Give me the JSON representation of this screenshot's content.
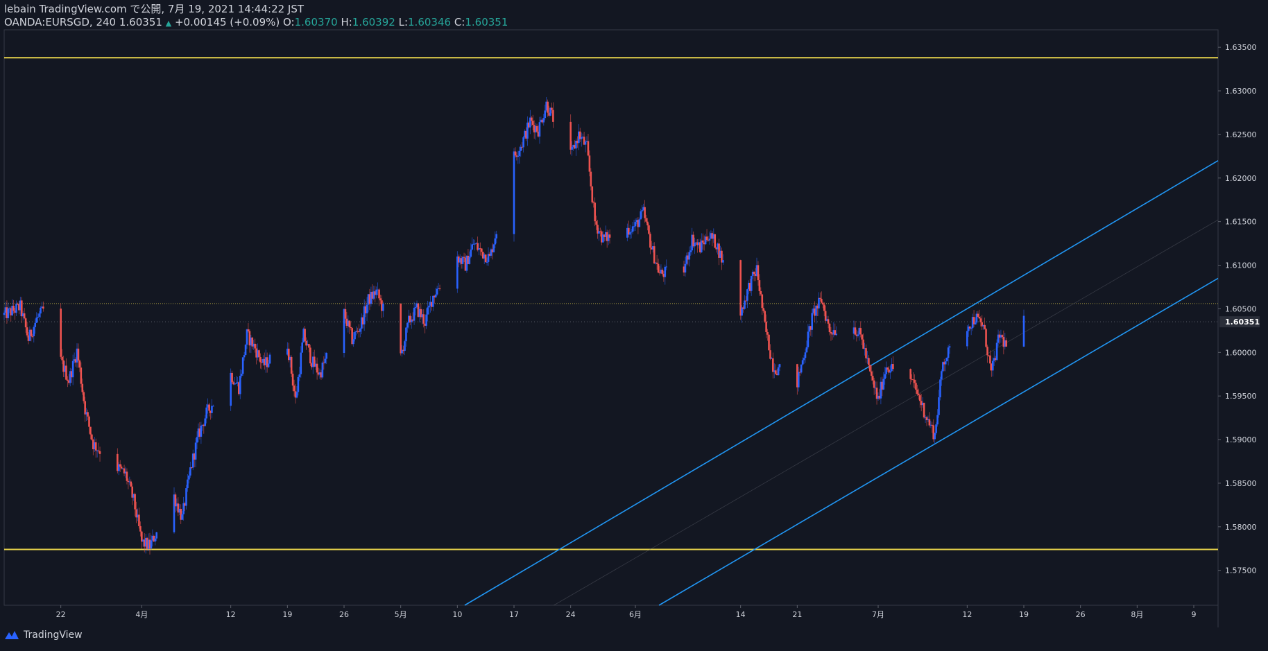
{
  "header": {
    "line1": "lebain TradingView.com で公開, 7月 19, 2021 14:44:22 JST",
    "symbol": "OANDA:EURSGD, 240 1.60351",
    "change_arrow": "▲",
    "change": "+0.00145 (+0.09%)",
    "o_label": "O:",
    "o_value": "1.60370",
    "h_label": "H:",
    "h_value": "1.60392",
    "l_label": "L:",
    "l_value": "1.60346",
    "c_label": "C:",
    "c_value": "1.60351"
  },
  "footer": {
    "brand": "TradingView"
  },
  "colors": {
    "background": "#131722",
    "up": "#2962ff",
    "down": "#ef5350",
    "levels": "#e6d24b",
    "channel": "#2196f3",
    "axis_text": "#d1d4dc"
  },
  "chart_data": {
    "type": "candlestick",
    "ylim": [
      1.571,
      1.637
    ],
    "y_ticks": [
      "1.57500",
      "1.58000",
      "1.58500",
      "1.59000",
      "1.59500",
      "1.60000",
      "1.60500",
      "1.61000",
      "1.61500",
      "1.62000",
      "1.62500",
      "1.63000",
      "1.63500"
    ],
    "x_ticks": [
      "22",
      "4月",
      "12",
      "19",
      "26",
      "5月",
      "10",
      "17",
      "24",
      "6月",
      "14",
      "21",
      "7月",
      "12",
      "19",
      "26",
      "8月",
      "9"
    ],
    "x_tick_dates": [
      "2021-03-22",
      "2021-04-01",
      "2021-04-12",
      "2021-04-19",
      "2021-04-26",
      "2021-05-03",
      "2021-05-10",
      "2021-05-17",
      "2021-05-24",
      "2021-06-01",
      "2021-06-14",
      "2021-06-21",
      "2021-07-01",
      "2021-07-12",
      "2021-07-19",
      "2021-07-26",
      "2021-08-02",
      "2021-08-09"
    ],
    "last_price": "1.60351",
    "close_path": [
      [
        "2021-03-15",
        1.6043
      ],
      [
        "2021-03-17",
        1.6052
      ],
      [
        "2021-03-18",
        1.6015
      ],
      [
        "2021-03-19",
        1.6038
      ],
      [
        "2021-03-20",
        1.605
      ],
      [
        "2021-03-22",
        1.599
      ],
      [
        "2021-03-23",
        1.5968
      ],
      [
        "2021-03-24",
        1.6002
      ],
      [
        "2021-03-25",
        1.5935
      ],
      [
        "2021-03-26",
        1.5895
      ],
      [
        "2021-03-29",
        1.5868
      ],
      [
        "2021-03-30",
        1.586
      ],
      [
        "2021-03-31",
        1.583
      ],
      [
        "2021-04-01",
        1.5782
      ],
      [
        "2021-04-02",
        1.5778
      ],
      [
        "2021-04-05",
        1.5835
      ],
      [
        "2021-04-06",
        1.581
      ],
      [
        "2021-04-07",
        1.5865
      ],
      [
        "2021-04-08",
        1.5905
      ],
      [
        "2021-04-09",
        1.593
      ],
      [
        "2021-04-12",
        1.5975
      ],
      [
        "2021-04-13",
        1.596
      ],
      [
        "2021-04-14",
        1.602
      ],
      [
        "2021-04-15",
        1.6005
      ],
      [
        "2021-04-16",
        1.5985
      ],
      [
        "2021-04-19",
        1.601
      ],
      [
        "2021-04-20",
        1.5945
      ],
      [
        "2021-04-21",
        1.602
      ],
      [
        "2021-04-22",
        1.599
      ],
      [
        "2021-04-23",
        1.5975
      ],
      [
        "2021-04-26",
        1.6045
      ],
      [
        "2021-04-27",
        1.6015
      ],
      [
        "2021-04-28",
        1.603
      ],
      [
        "2021-04-29",
        1.606
      ],
      [
        "2021-04-30",
        1.607
      ],
      [
        "2021-05-03",
        1.5995
      ],
      [
        "2021-05-04",
        1.6035
      ],
      [
        "2021-05-05",
        1.605
      ],
      [
        "2021-05-06",
        1.6035
      ],
      [
        "2021-05-07",
        1.6065
      ],
      [
        "2021-05-10",
        1.611
      ],
      [
        "2021-05-11",
        1.61
      ],
      [
        "2021-05-12",
        1.6125
      ],
      [
        "2021-05-13",
        1.6115
      ],
      [
        "2021-05-14",
        1.6108
      ],
      [
        "2021-05-17",
        1.6225
      ],
      [
        "2021-05-18",
        1.624
      ],
      [
        "2021-05-19",
        1.6265
      ],
      [
        "2021-05-20",
        1.6255
      ],
      [
        "2021-05-21",
        1.6285
      ],
      [
        "2021-05-24",
        1.6225
      ],
      [
        "2021-05-25",
        1.625
      ],
      [
        "2021-05-26",
        1.6235
      ],
      [
        "2021-05-27",
        1.615
      ],
      [
        "2021-05-28",
        1.613
      ],
      [
        "2021-06-01",
        1.6145
      ],
      [
        "2021-06-02",
        1.616
      ],
      [
        "2021-06-03",
        1.612
      ],
      [
        "2021-06-04",
        1.609
      ],
      [
        "2021-06-07",
        1.6095
      ],
      [
        "2021-06-08",
        1.613
      ],
      [
        "2021-06-09",
        1.612
      ],
      [
        "2021-06-10",
        1.6135
      ],
      [
        "2021-06-11",
        1.6125
      ],
      [
        "2021-06-14",
        1.6045
      ],
      [
        "2021-06-15",
        1.6075
      ],
      [
        "2021-06-16",
        1.6095
      ],
      [
        "2021-06-17",
        1.603
      ],
      [
        "2021-06-18",
        1.5985
      ],
      [
        "2021-06-21",
        1.5965
      ],
      [
        "2021-06-22",
        1.6005
      ],
      [
        "2021-06-23",
        1.6045
      ],
      [
        "2021-06-24",
        1.606
      ],
      [
        "2021-06-25",
        1.6025
      ],
      [
        "2021-06-28",
        1.603
      ],
      [
        "2021-06-29",
        1.6015
      ],
      [
        "2021-06-30",
        1.5975
      ],
      [
        "2021-07-01",
        1.5945
      ],
      [
        "2021-07-02",
        1.5985
      ],
      [
        "2021-07-05",
        1.597
      ],
      [
        "2021-07-06",
        1.595
      ],
      [
        "2021-07-07",
        1.5925
      ],
      [
        "2021-07-08",
        1.5905
      ],
      [
        "2021-07-09",
        1.599
      ],
      [
        "2021-07-12",
        1.603
      ],
      [
        "2021-07-13",
        1.604
      ],
      [
        "2021-07-14",
        1.603
      ],
      [
        "2021-07-15",
        1.5975
      ],
      [
        "2021-07-16",
        1.602
      ],
      [
        "2021-07-17",
        1.6005
      ],
      [
        "2021-07-19",
        1.6035
      ]
    ],
    "horizontal_levels": [
      1.6338,
      1.5774
    ],
    "dotted_level": 1.6056,
    "channel": {
      "upper": [
        [
          "2021-05-10",
          1.5705
        ],
        [
          "2021-08-12",
          1.622
        ]
      ],
      "lower": [
        [
          "2021-06-03",
          1.5705
        ],
        [
          "2021-08-12",
          1.6085
        ]
      ],
      "middle": [
        [
          "2021-05-21",
          1.5705
        ],
        [
          "2021-08-12",
          1.6152
        ]
      ]
    }
  }
}
